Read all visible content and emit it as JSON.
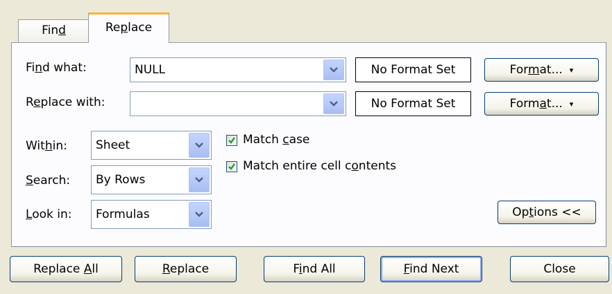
{
  "tabs": {
    "find": {
      "pre": "Fin",
      "key": "d",
      "post": ""
    },
    "replace": {
      "pre": "Re",
      "key": "p",
      "post": "lace"
    }
  },
  "find_what": {
    "label_pre": "Fi",
    "label_key": "n",
    "label_post": "d what:",
    "value": "NULL",
    "format": "No Format Set"
  },
  "replace_with": {
    "label_pre": "R",
    "label_key": "e",
    "label_post": "place with:",
    "value": "",
    "format": "No Format Set"
  },
  "format_btn_1": {
    "pre": "For",
    "key": "m",
    "post": "at...",
    "arrow": "▾"
  },
  "format_btn_2": {
    "pre": "Form",
    "key": "a",
    "post": "t...",
    "arrow": "▾"
  },
  "within": {
    "label_pre": "Wit",
    "label_key": "h",
    "label_post": "in:",
    "value": "Sheet"
  },
  "search": {
    "label_pre": "",
    "label_key": "S",
    "label_post": "earch:",
    "value": "By Rows"
  },
  "look_in": {
    "label_pre": "",
    "label_key": "L",
    "label_post": "ook in:",
    "value": "Formulas"
  },
  "match_case": {
    "pre": "Match ",
    "key": "c",
    "post": "ase",
    "checked": true
  },
  "match_entire": {
    "pre": "Match entire cell c",
    "key": "o",
    "post": "ntents",
    "checked": true
  },
  "options": {
    "pre": "Op",
    "key": "t",
    "post": "ions <<"
  },
  "buttons": {
    "replace_all": {
      "pre": "Replace ",
      "key": "A",
      "post": "ll"
    },
    "replace": {
      "pre": "",
      "key": "R",
      "post": "eplace"
    },
    "find_all": {
      "pre": "F",
      "key": "i",
      "post": "nd All"
    },
    "find_next": {
      "pre": "",
      "key": "F",
      "post": "ind Next"
    },
    "close": {
      "label": "Close"
    }
  },
  "colors": {
    "dialog_bg": "#ECE9D8",
    "panel_bg": "#FCFCFE",
    "active_tab_accent": "#F6B53A",
    "button_border": "#003C74",
    "checkmark": "#21A121"
  },
  "icons": {
    "dropdown": "chevron-down-icon",
    "checkbox": "checkmark-icon"
  }
}
